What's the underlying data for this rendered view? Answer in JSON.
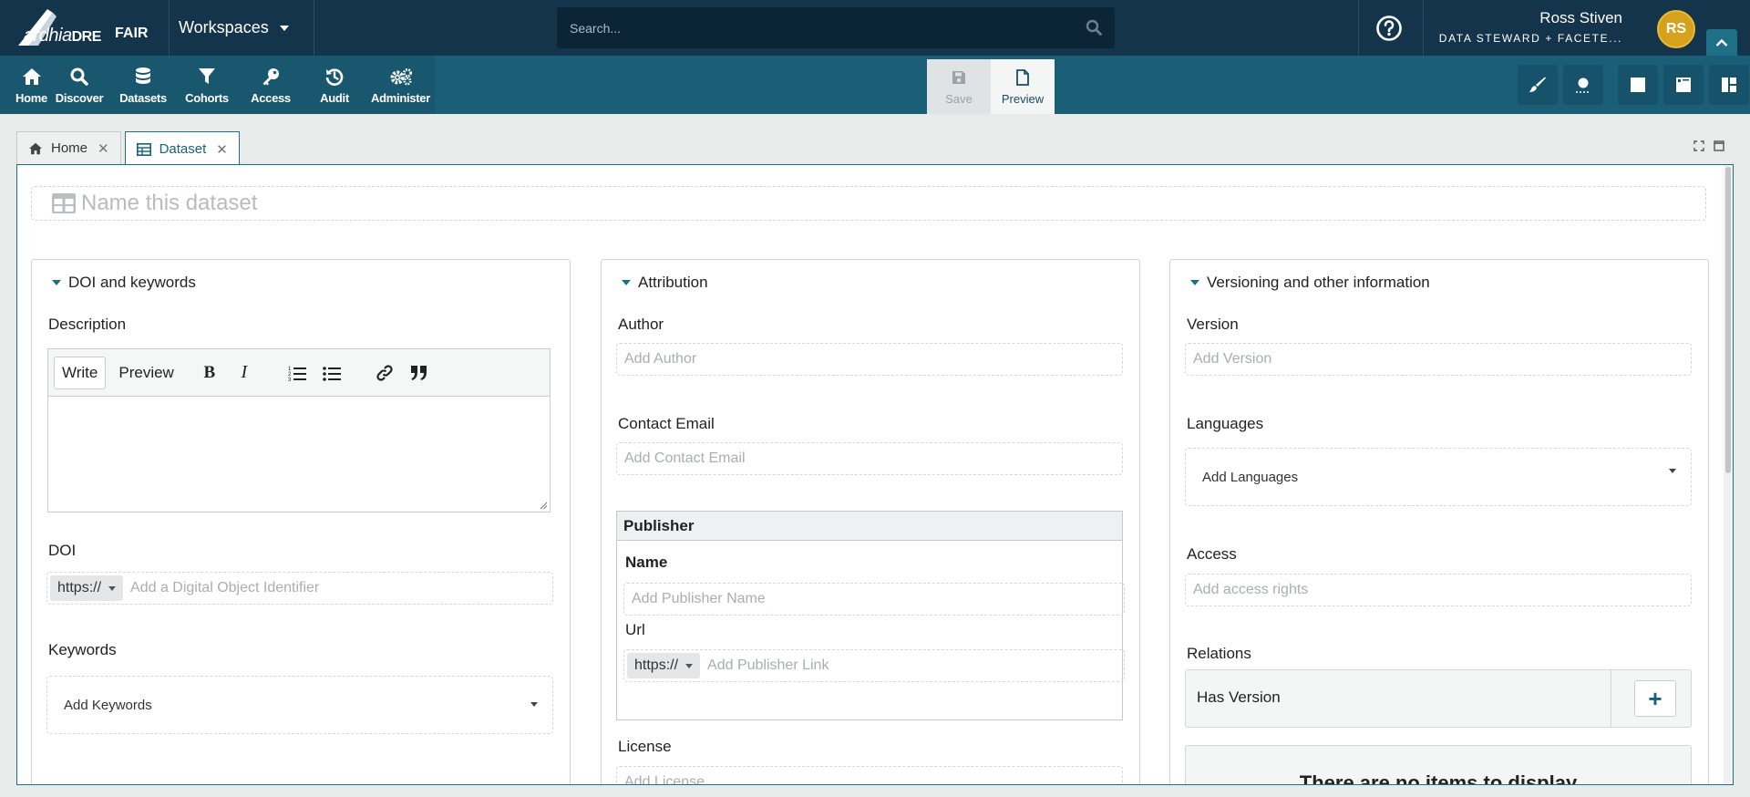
{
  "app": {
    "brand": "ardhia",
    "brand_sub": "DRE",
    "fair_label": "FAIR",
    "workspaces_label": "Workspaces"
  },
  "search": {
    "placeholder": "Search..."
  },
  "user": {
    "name": "Ross Stiven",
    "role": "DATA STEWARD + FACETE...",
    "initials": "RS",
    "avatar_color": "#d6a21e"
  },
  "nav": [
    {
      "label": "Home",
      "icon": "home-icon"
    },
    {
      "label": "Discover",
      "icon": "search-icon"
    },
    {
      "label": "Datasets",
      "icon": "database-icon"
    },
    {
      "label": "Cohorts",
      "icon": "filter-icon"
    },
    {
      "label": "Access",
      "icon": "key-icon"
    },
    {
      "label": "Audit",
      "icon": "history-icon"
    },
    {
      "label": "Administer",
      "icon": "gears-icon"
    }
  ],
  "actions": {
    "save": "Save",
    "preview": "Preview"
  },
  "tabs": [
    {
      "label": "Home",
      "icon": "home-icon"
    },
    {
      "label": "Dataset",
      "icon": "table-icon"
    }
  ],
  "dataset": {
    "name_placeholder": "Name this dataset"
  },
  "panel1": {
    "title": "DOI and keywords",
    "description_label": "Description",
    "editor": {
      "write": "Write",
      "preview": "Preview"
    },
    "doi_label": "DOI",
    "doi_protocol": "https://",
    "doi_placeholder": "Add a Digital Object Identifier",
    "keywords_label": "Keywords",
    "keywords_placeholder": "Add Keywords"
  },
  "panel2": {
    "title": "Attribution",
    "author_label": "Author",
    "author_placeholder": "Add Author",
    "email_label": "Contact Email",
    "email_placeholder": "Add Contact Email",
    "publisher": {
      "title": "Publisher",
      "name_label": "Name",
      "name_placeholder": "Add Publisher Name",
      "url_label": "Url",
      "url_protocol": "https://",
      "url_placeholder": "Add Publisher Link"
    },
    "license_label": "License",
    "license_placeholder": "Add License"
  },
  "panel3": {
    "title": "Versioning and other information",
    "version_label": "Version",
    "version_placeholder": "Add Version",
    "languages_label": "Languages",
    "languages_placeholder": "Add Languages",
    "access_label": "Access",
    "access_placeholder": "Add access rights",
    "relations_label": "Relations",
    "has_version_label": "Has Version",
    "add_label": "+",
    "empty_text": "There are no items to display"
  },
  "colors": {
    "topbar": "#13344a",
    "toolbar": "#1a5f77",
    "accent": "#1f6f86"
  }
}
